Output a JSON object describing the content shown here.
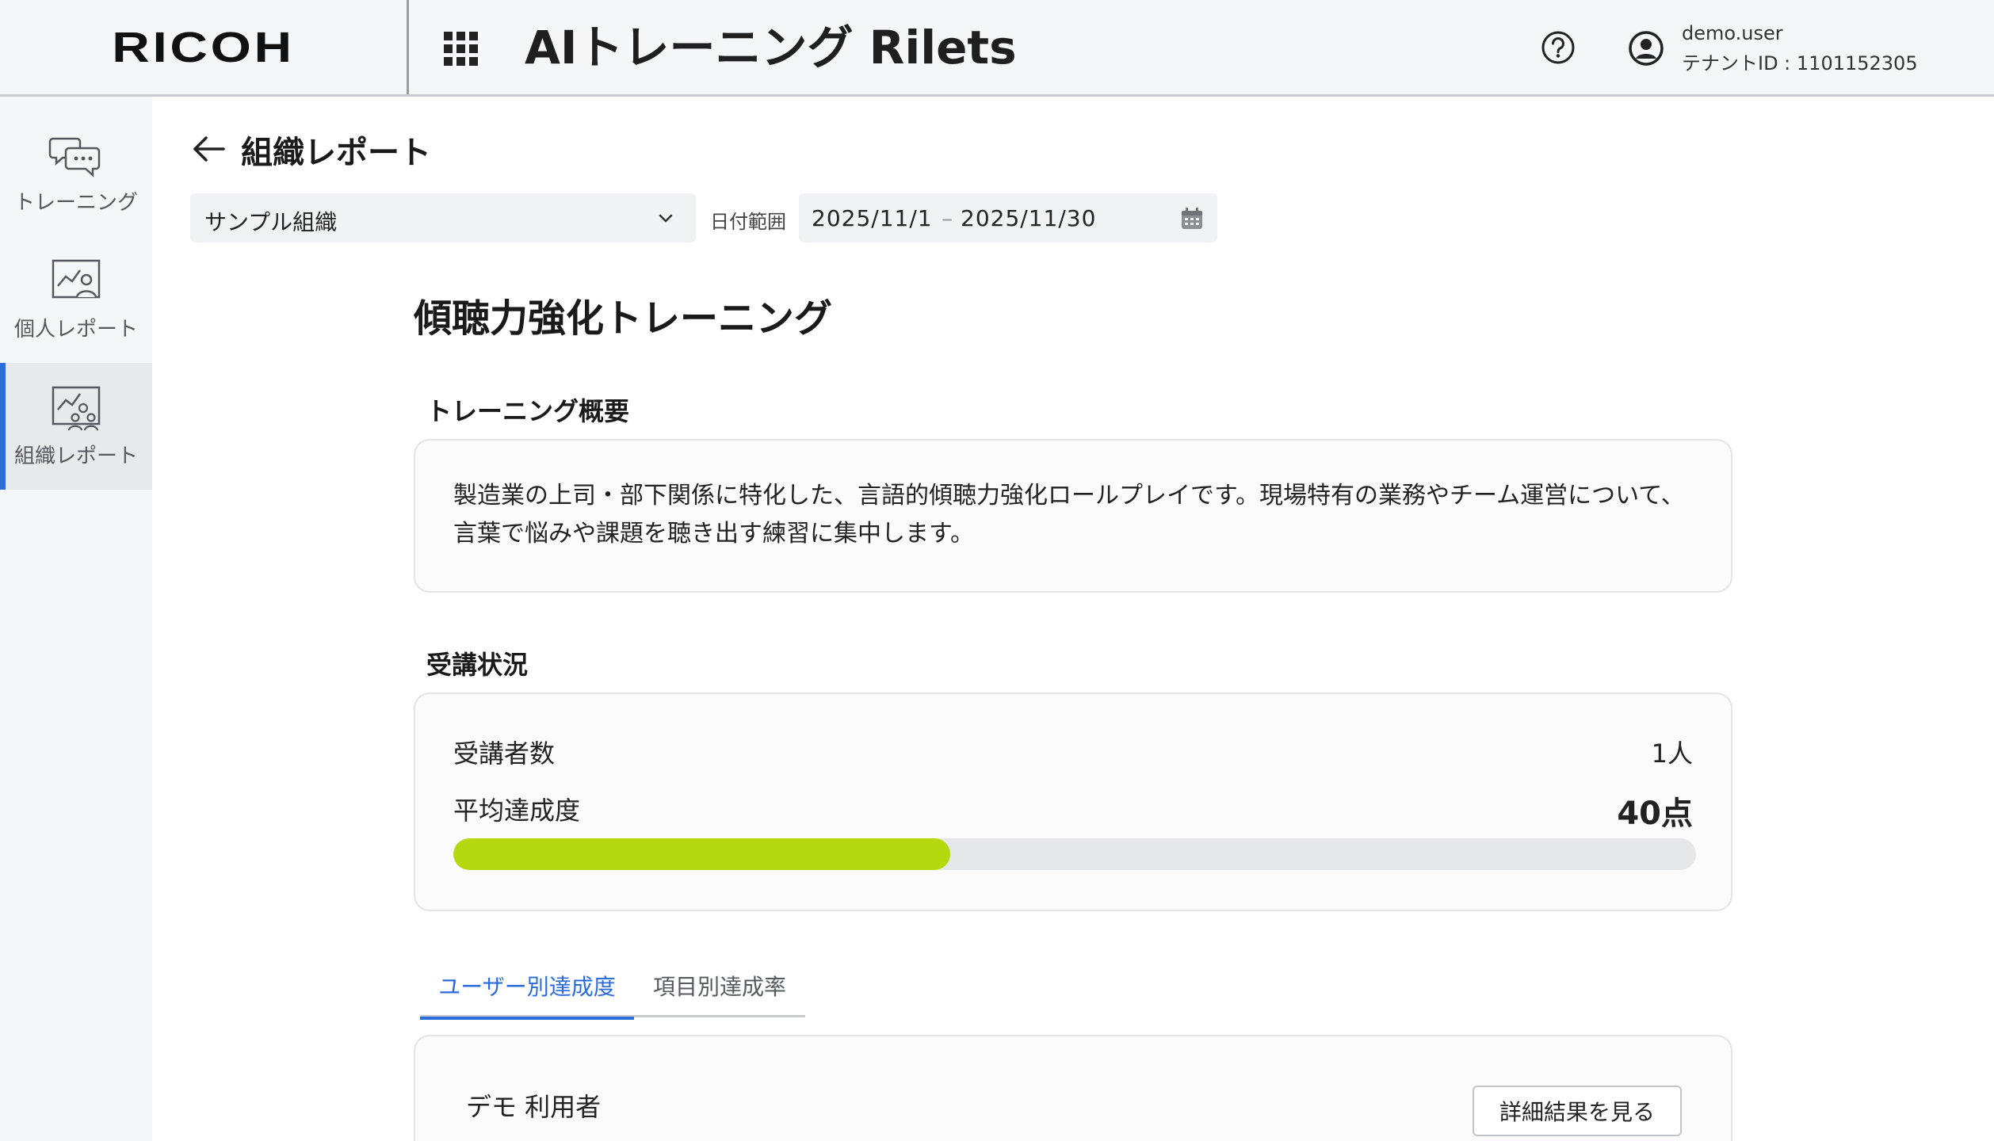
{
  "header": {
    "logo": "RICOH",
    "app_title": "AIトレーニング Rilets",
    "user_name": "demo.user",
    "tenant_id": "テナントID : 1101152305"
  },
  "sidebar": {
    "items": [
      {
        "label": "トレーニング",
        "icon": "chat-bubbles-icon",
        "active": false
      },
      {
        "label": "個人レポート",
        "icon": "personal-report-icon",
        "active": false
      },
      {
        "label": "組織レポート",
        "icon": "org-report-icon",
        "active": true
      }
    ]
  },
  "page": {
    "title": "組織レポート",
    "org_select_value": "サンプル組織",
    "date_label": "日付範囲",
    "date_start": "2025/11/1",
    "date_separator": "–",
    "date_end": "2025/11/30"
  },
  "training": {
    "title": "傾聴力強化トレーニング",
    "overview_heading": "トレーニング概要",
    "overview_text": "製造業の上司・部下関係に特化した、言語的傾聴力強化ロールプレイです。現場特有の業務やチーム運営について、言葉で悩みや課題を聴き出す練習に集中します。",
    "status_heading": "受講状況",
    "participants_label": "受講者数",
    "participants_value": "1人",
    "avg_label": "平均達成度",
    "avg_value": "40点",
    "avg_percent": 40
  },
  "tabs": [
    {
      "label": "ユーザー別達成度",
      "active": true
    },
    {
      "label": "項目別達成率",
      "active": false
    }
  ],
  "user_results": {
    "user_name": "デモ 利用者",
    "detail_button": "詳細結果を見る"
  },
  "colors": {
    "accent": "#2c6bdb",
    "progress": "#b5d80e",
    "track": "#e6e7e9"
  }
}
